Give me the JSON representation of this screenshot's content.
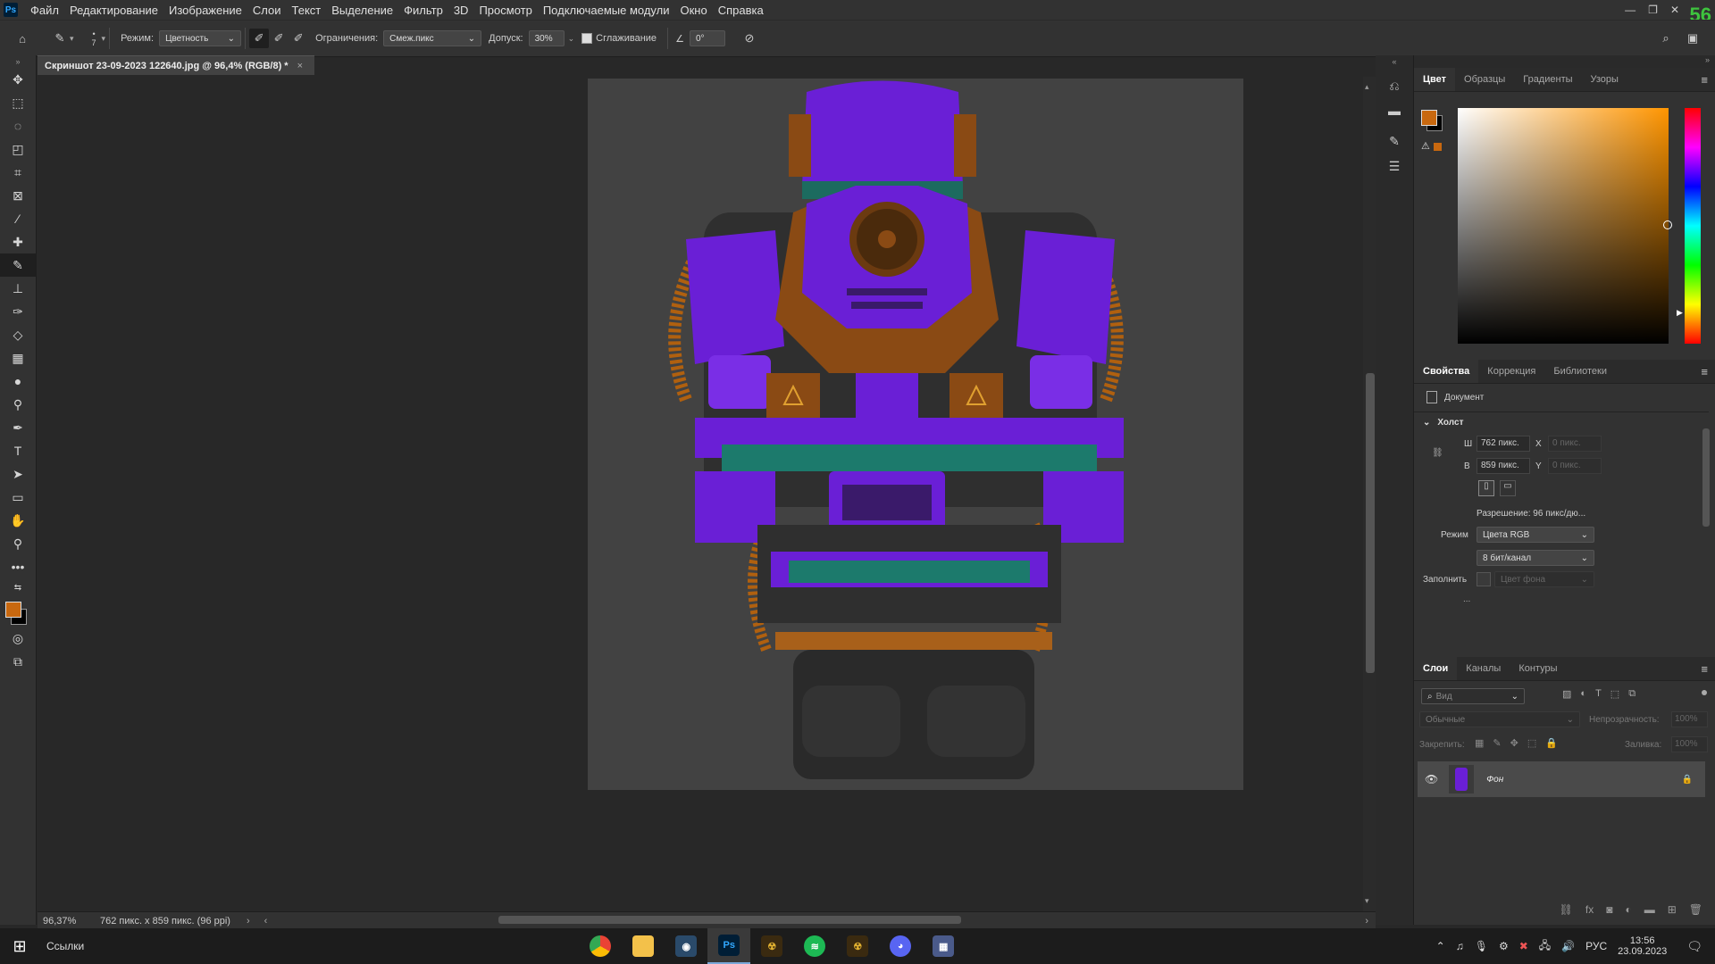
{
  "menubar": {
    "app_logo": "Ps",
    "items": [
      "Файл",
      "Редактирование",
      "Изображение",
      "Слои",
      "Текст",
      "Выделение",
      "Фильтр",
      "3D",
      "Просмотр",
      "Подключаемые модули",
      "Окно",
      "Справка"
    ],
    "corner_number": "56"
  },
  "options": {
    "brush_size": "7",
    "mode_label": "Режим:",
    "mode_value": "Цветность",
    "limits_label": "Ограничения:",
    "limits_value": "Смеж.пикс",
    "tolerance_label": "Допуск:",
    "tolerance_value": "30%",
    "antialias_label": "Сглаживание",
    "angle_value": "0°"
  },
  "document": {
    "tab_title": "Скриншот 23-09-2023 122640.jpg @ 96,4% (RGB/8) *"
  },
  "status": {
    "zoom": "96,37%",
    "info": "762 пикс. x 859 пикс. (96 ppi)"
  },
  "color_panel": {
    "tabs": [
      "Цвет",
      "Образцы",
      "Градиенты",
      "Узоры"
    ],
    "fg_color": "#c8680f",
    "bg_color": "#000000"
  },
  "properties_panel": {
    "tabs": [
      "Свойства",
      "Коррекция",
      "Библиотеки"
    ],
    "doc_label": "Документ",
    "section": "Холст",
    "w_label": "Ш",
    "w_value": "762 пикс.",
    "h_label": "В",
    "h_value": "859 пикс.",
    "x_label": "X",
    "x_placeholder": "0 пикс.",
    "y_label": "Y",
    "y_placeholder": "0 пикс.",
    "resolution": "Разрешение: 96 пикс/дю...",
    "mode_label": "Режим",
    "mode_value": "Цвета RGB",
    "depth_value": "8 бит/канал",
    "fill_label": "Заполнить",
    "fill_value": "Цвет фона",
    "more": "..."
  },
  "layers_panel": {
    "tabs": [
      "Слои",
      "Каналы",
      "Контуры"
    ],
    "search_placeholder": "Вид",
    "blend_mode": "Обычные",
    "opacity_label": "Непрозрачность:",
    "opacity_value": "100%",
    "lock_label": "Закрепить:",
    "fill_label": "Заливка:",
    "fill_value": "100%",
    "layers": [
      {
        "name": "Фон"
      }
    ]
  },
  "taskbar": {
    "search_text": "Ссылки",
    "lang": "РУС",
    "time": "13:56",
    "date": "23.09.2023"
  }
}
